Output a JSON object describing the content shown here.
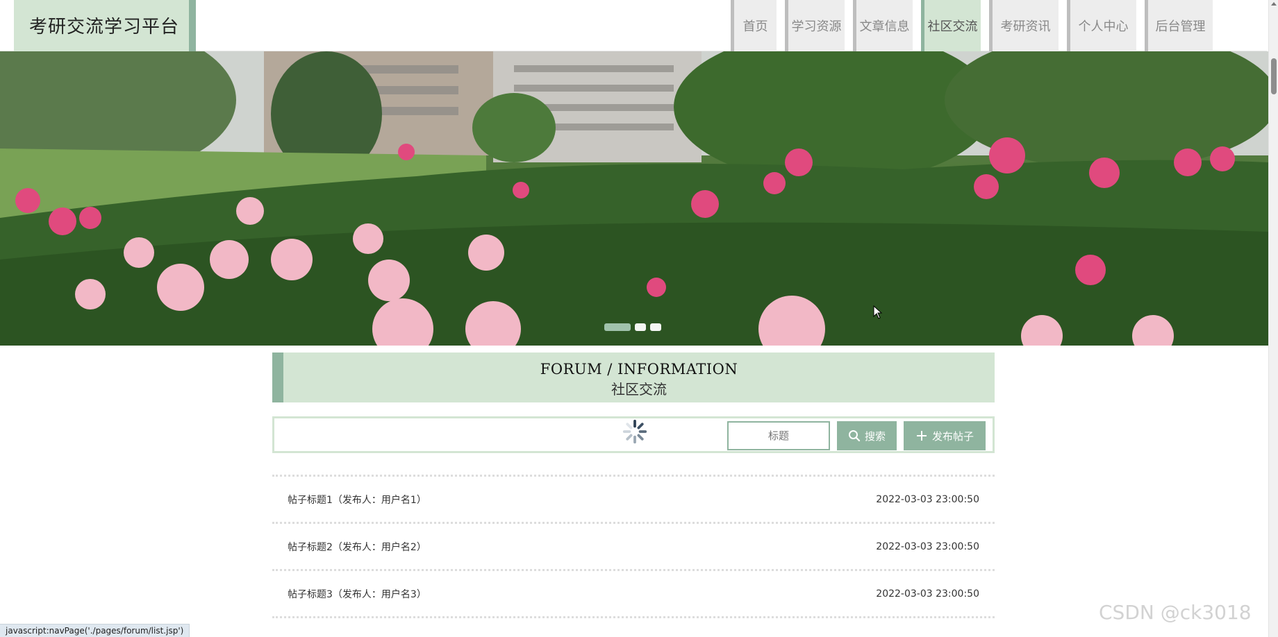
{
  "header": {
    "logo_text": "考研交流学习平台",
    "nav": [
      {
        "label": "首页",
        "active": false
      },
      {
        "label": "学习资源",
        "active": false
      },
      {
        "label": "文章信息",
        "active": false
      },
      {
        "label": "社区交流",
        "active": true
      },
      {
        "label": "考研资讯",
        "active": false
      },
      {
        "label": "个人中心",
        "active": false
      },
      {
        "label": "后台管理",
        "active": false
      }
    ]
  },
  "banner": {
    "slide_count": 3,
    "active_slide": 1
  },
  "section": {
    "title_en": "FORUM / INFORMATION",
    "title_zh": "社区交流"
  },
  "search": {
    "placeholder": "标题",
    "value": "",
    "search_label": "搜索",
    "post_label": "发布帖子"
  },
  "posts": [
    {
      "title": "帖子标题1（发布人：用户名1）",
      "time": "2022-03-03 23:00:50"
    },
    {
      "title": "帖子标题2（发布人：用户名2）",
      "time": "2022-03-03 23:00:50"
    },
    {
      "title": "帖子标题3（发布人：用户名3）",
      "time": "2022-03-03 23:00:50"
    }
  ],
  "status_bar": "javascript:navPage('./pages/forum/list.jsp')",
  "watermark": "CSDN @ck3018",
  "colors": {
    "accent": "#8fb49f",
    "accent_light": "#d3e5d3",
    "nav_bg": "#ededed"
  },
  "icons": {
    "search": "search-icon",
    "post": "plus-icon",
    "loading": "spinner-icon"
  }
}
